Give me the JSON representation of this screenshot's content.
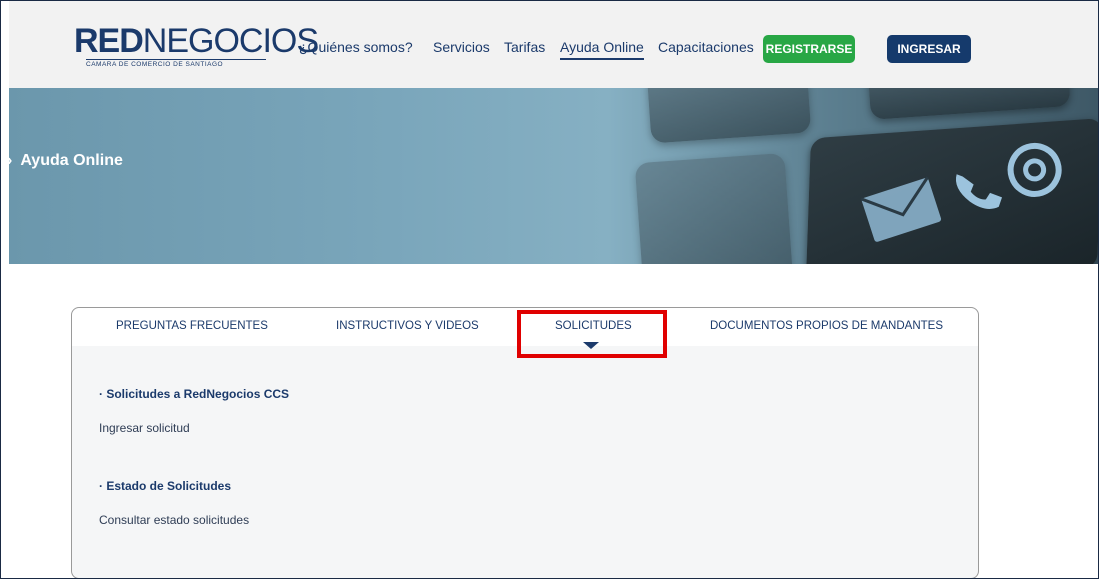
{
  "brand": {
    "logo_main_bold": "RED",
    "logo_main_rest": "NEGOCIOS",
    "logo_sub": "CAMARA DE COMERCIO DE SANTIAGO"
  },
  "nav": {
    "items": [
      {
        "label": "¿Quiénes somos?"
      },
      {
        "label": "Servicios"
      },
      {
        "label": "Tarifas"
      },
      {
        "label": "Ayuda Online",
        "active": true
      },
      {
        "label": "Capacitaciones"
      }
    ],
    "register_label": "REGISTRARSE",
    "login_label": "INGRESAR"
  },
  "hero": {
    "chevron": "›",
    "title": "Ayuda Online"
  },
  "tabs": [
    {
      "label": "PREGUNTAS FRECUENTES"
    },
    {
      "label": "INSTRUCTIVOS Y VIDEOS"
    },
    {
      "label": "SOLICITUDES",
      "selected": true
    },
    {
      "label": "DOCUMENTOS PROPIOS DE MANDANTES"
    }
  ],
  "content": {
    "sections": [
      {
        "title": "· Solicitudes a RedNegocios CCS",
        "link": "Ingresar solicitud"
      },
      {
        "title": "· Estado de Solicitudes",
        "link": "Consultar estado solicitudes"
      }
    ]
  },
  "colors": {
    "brand_navy": "#1b3a6b",
    "register_green": "#28a745",
    "highlight_red": "#e00000"
  }
}
